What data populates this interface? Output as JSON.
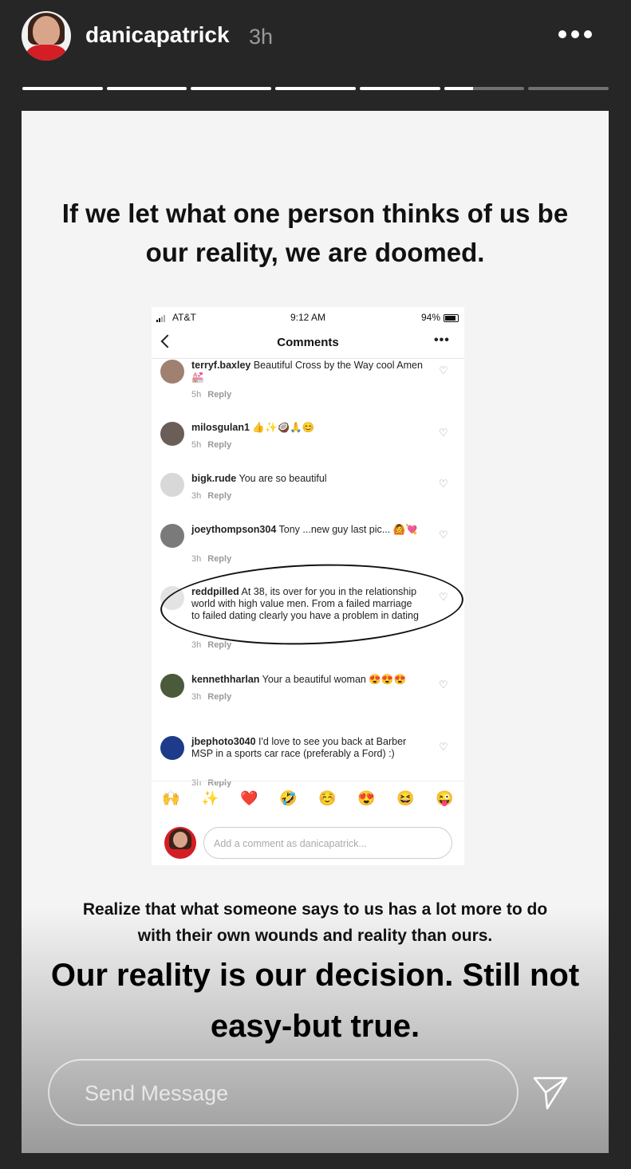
{
  "header": {
    "username": "danicapatrick",
    "time": "3h",
    "progress": [
      1,
      1,
      1,
      1,
      1,
      0.36,
      0
    ]
  },
  "story": {
    "headline": "If we let what one person thinks of us be our reality, we are doomed.",
    "caption_small": "Realize that what someone says to us has a lot more to do with their own wounds and reality than ours.",
    "caption_large": "Our reality is our decision. Still not easy-but true."
  },
  "screenshot": {
    "carrier": "AT&T",
    "clock": "9:12 AM",
    "battery": "94%",
    "title": "Comments",
    "comments": [
      {
        "user": "terryf.baxley",
        "text": "Beautiful Cross by the Way cool Amen 💒",
        "time": "5h",
        "reply": "Reply"
      },
      {
        "user": "milosgulan1",
        "text": "👍✨🥥🙏😊",
        "time": "5h",
        "reply": "Reply"
      },
      {
        "user": "bigk.rude",
        "text": "You are so beautiful",
        "time": "3h",
        "reply": "Reply"
      },
      {
        "user": "joeythompson304",
        "text": "Tony ...new guy last pic... 🙆💘",
        "time": "3h",
        "reply": "Reply"
      },
      {
        "user": "reddpilled",
        "text": "At 38, its over for you in the relationship world with high value men. From a failed marriage to failed dating clearly you have a problem in dating",
        "time": "3h",
        "reply": "Reply"
      },
      {
        "user": "kennethharlan",
        "text": "Your a beautiful woman 😍😍😍",
        "time": "3h",
        "reply": "Reply"
      },
      {
        "user": "jbephoto3040",
        "text": "I'd love to see you back at Barber MSP in a sports car race (preferably a Ford) :)",
        "time": "3h",
        "reply": "Reply"
      }
    ],
    "emojis": [
      "🙌",
      "✨",
      "❤️",
      "🤣",
      "☺️",
      "😍",
      "😆",
      "😜"
    ],
    "add_comment_placeholder": "Add a comment as danicapatrick..."
  },
  "footer": {
    "send_placeholder": "Send Message"
  }
}
